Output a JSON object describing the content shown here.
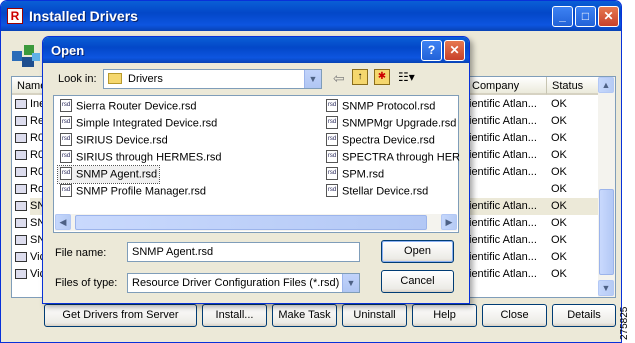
{
  "main_window": {
    "title": "Installed Drivers",
    "columns": [
      "Name",
      "Company",
      "Status"
    ],
    "rows": [
      {
        "name": "Ine",
        "company": "ientific Atlan...",
        "status": "OK"
      },
      {
        "name": "Re",
        "company": "ientific Atlan...",
        "status": "OK"
      },
      {
        "name": "R0",
        "company": "ientific Atlan...",
        "status": "OK"
      },
      {
        "name": "R0",
        "company": "ientific Atlan...",
        "status": "OK"
      },
      {
        "name": "R0",
        "company": "ientific Atlan...",
        "status": "OK"
      },
      {
        "name": "Ro",
        "company": "",
        "status": "OK"
      },
      {
        "name": "SN",
        "company": "ientific Atlan...",
        "status": "OK"
      },
      {
        "name": "SN",
        "company": "ientific Atlan...",
        "status": "OK"
      },
      {
        "name": "SN",
        "company": "ientific Atlan...",
        "status": "OK"
      },
      {
        "name": "Vic",
        "company": "ientific Atlan...",
        "status": "OK"
      },
      {
        "name": "Vic",
        "company": "ientific Atlan...",
        "status": "OK"
      }
    ],
    "buttons": {
      "get_drivers": "Get Drivers from Server",
      "install": "Install...",
      "make_task": "Make Task",
      "uninstall": "Uninstall",
      "help": "Help",
      "close": "Close",
      "details": "Details"
    }
  },
  "open_dialog": {
    "title": "Open",
    "look_in_label": "Look in:",
    "look_in_value": "Drivers",
    "files_col1": [
      "Sierra Router Device.rsd",
      "Simple Integrated Device.rsd",
      "SIRIUS Device.rsd",
      "SIRIUS through HERMES.rsd",
      "SNMP Agent.rsd",
      "SNMP Profile Manager.rsd"
    ],
    "files_col2": [
      "SNMP Protocol.rsd",
      "SNMPMgr Upgrade.rsd",
      "Spectra Device.rsd",
      "SPECTRA through HERMI",
      "SPM.rsd",
      "Stellar Device.rsd"
    ],
    "file_icon_text": "rsd",
    "file_name_label": "File name:",
    "file_name_value": "SNMP Agent.rsd",
    "files_of_type_label": "Files of type:",
    "files_of_type_value": "Resource Driver Configuration Files (*.rsd)",
    "open_button": "Open",
    "cancel_button": "Cancel"
  },
  "figure_id": "275825",
  "colors": {
    "title_bar": "#0347c8",
    "window_bg": "#ece9d8",
    "close_btn": "#c8412b"
  }
}
